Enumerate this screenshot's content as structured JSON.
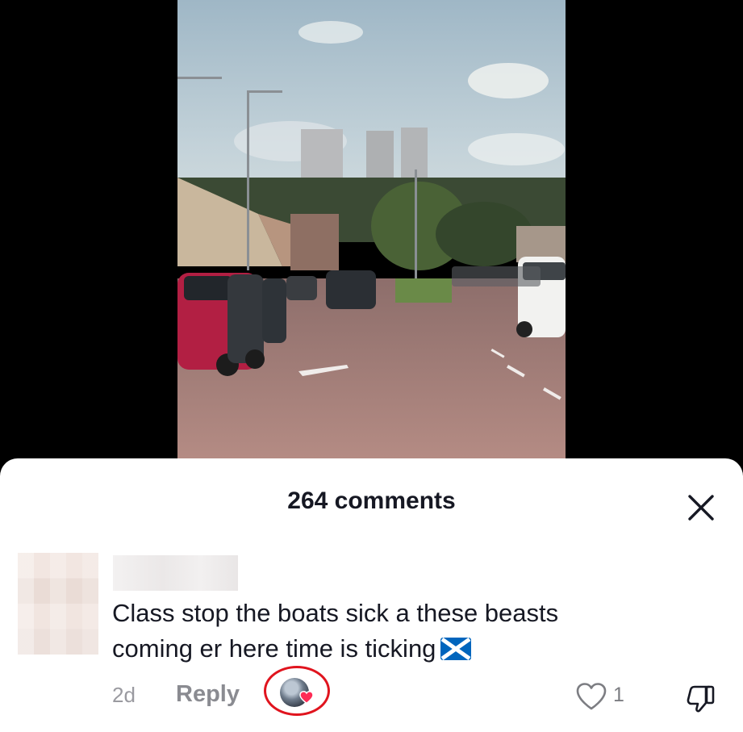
{
  "video": {
    "description": "street-scene-video"
  },
  "comments_sheet": {
    "title": "264 comments",
    "close_icon": "close-icon"
  },
  "comment": {
    "text_line1": "Class stop the boats sick a these beasts",
    "text_line2": "coming er here time is ticking",
    "emoji": "scotland-flag-icon",
    "time": "2d",
    "reply_label": "Reply",
    "like_count": "1",
    "creator_liked": true
  },
  "colors": {
    "highlight_ring": "#e0141e",
    "heart": "#fe2c55",
    "text": "#161823",
    "muted": "#9a9aa0"
  }
}
